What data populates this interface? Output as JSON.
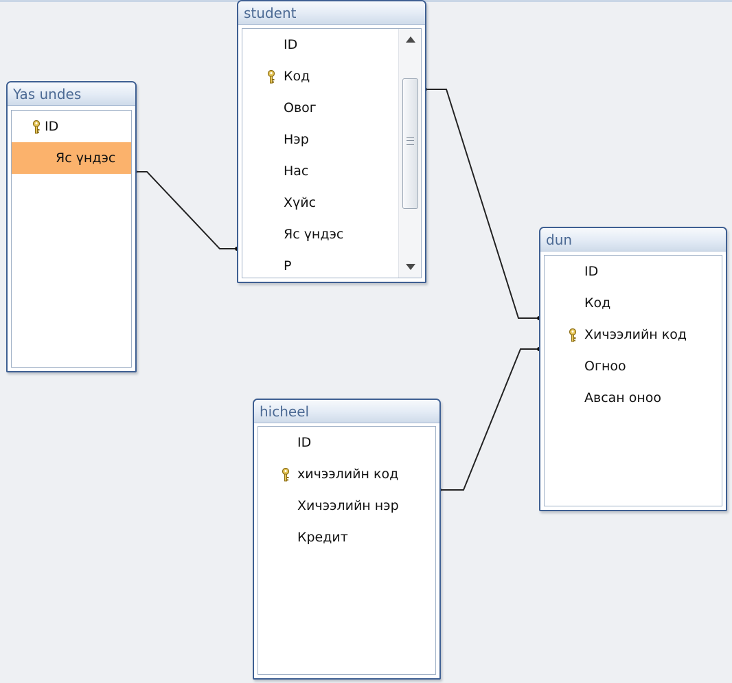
{
  "tables": {
    "yas_undes": {
      "title": "Yas undes",
      "fields": [
        {
          "label": "ID",
          "primary_key": true,
          "selected": false
        },
        {
          "label": "Яс үндэс",
          "primary_key": false,
          "selected": true
        }
      ]
    },
    "student": {
      "title": "student",
      "fields": [
        {
          "label": "ID",
          "primary_key": false
        },
        {
          "label": "Код",
          "primary_key": true
        },
        {
          "label": "Овог",
          "primary_key": false
        },
        {
          "label": "Нэр",
          "primary_key": false
        },
        {
          "label": "Нас",
          "primary_key": false
        },
        {
          "label": "Хүйс",
          "primary_key": false
        },
        {
          "label": "Яс үндэс",
          "primary_key": false
        },
        {
          "label": "Р",
          "primary_key": false
        }
      ],
      "has_scrollbar": true
    },
    "dun": {
      "title": "dun",
      "fields": [
        {
          "label": "ID",
          "primary_key": false
        },
        {
          "label": "Код",
          "primary_key": false
        },
        {
          "label": "Хичээлийн код",
          "primary_key": true
        },
        {
          "label": "Огноо",
          "primary_key": false
        },
        {
          "label": "Авсан оноо",
          "primary_key": false
        }
      ]
    },
    "hicheel": {
      "title": "hicheel",
      "fields": [
        {
          "label": "ID",
          "primary_key": false
        },
        {
          "label": "хичээлийн код",
          "primary_key": true
        },
        {
          "label": "Хичээлийн нэр",
          "primary_key": false
        },
        {
          "label": "Кредит",
          "primary_key": false
        }
      ]
    }
  },
  "relationships": [
    {
      "from_table": "Yas undes",
      "from_field": "Яс үндэс",
      "to_table": "student",
      "to_field": "Яс үндэс"
    },
    {
      "from_table": "student",
      "from_field": "Код",
      "to_table": "dun",
      "to_field": "Код"
    },
    {
      "from_table": "hicheel",
      "from_field": "хичээлийн код",
      "to_table": "dun",
      "to_field": "Хичээлийн код"
    }
  ],
  "colors": {
    "canvas_background": "#eef0f3",
    "table_border": "#3e5f92",
    "title_text": "#4c6a94",
    "selected_field": "#fbb26c",
    "relationship_line": "#222222",
    "key_icon": "#d8b84a"
  },
  "icons": {
    "primary_key": "key-icon",
    "scroll_up": "scroll-up-arrow-icon",
    "scroll_down": "scroll-down-arrow-icon"
  }
}
